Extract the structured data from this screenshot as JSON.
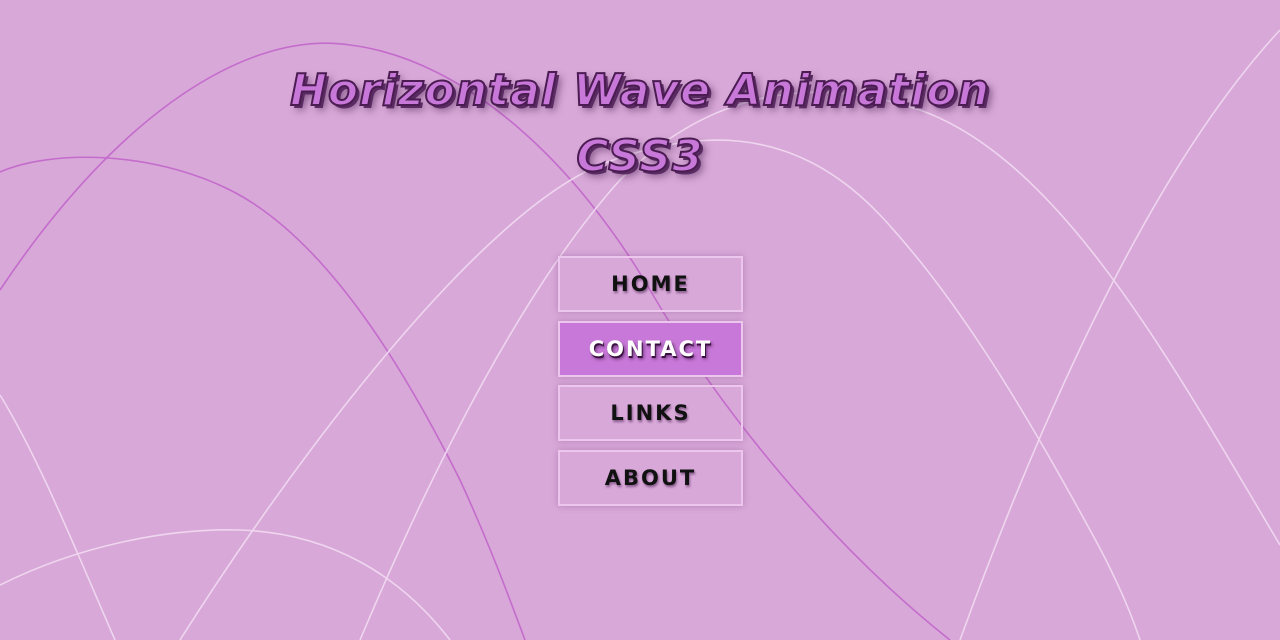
{
  "page": {
    "title_line1": "Horizontal Wave Animation",
    "title_line2": "CSS3"
  },
  "nav": {
    "items": [
      {
        "label": "HOME",
        "active": false
      },
      {
        "label": "CONTACT",
        "active": true
      },
      {
        "label": "LINKS",
        "active": false
      },
      {
        "label": "ABOUT",
        "active": false
      }
    ]
  },
  "colors": {
    "background": "#d8a8d8",
    "accent": "#c878d8",
    "wave_light": "#efd6ef",
    "wave_dark": "#c46ccc",
    "nav_border": "#ecc6ec",
    "title_outline": "#4a1c52"
  }
}
